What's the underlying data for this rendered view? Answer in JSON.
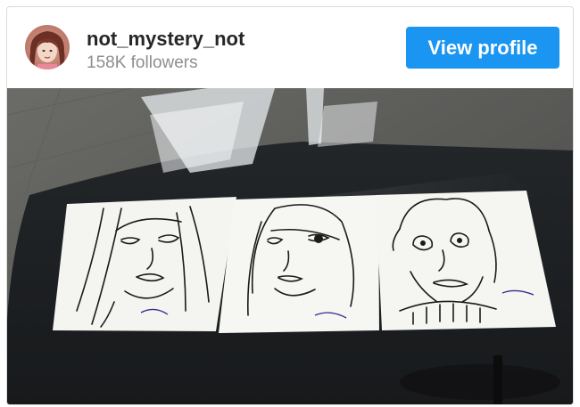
{
  "profile": {
    "username": "not_mystery_not",
    "followers": "158K followers",
    "view_label": "View profile"
  },
  "colors": {
    "accent": "#1a95f1",
    "username": "#262626",
    "muted": "#8e8e8e"
  },
  "icons": {
    "avatar": "profile-avatar"
  }
}
